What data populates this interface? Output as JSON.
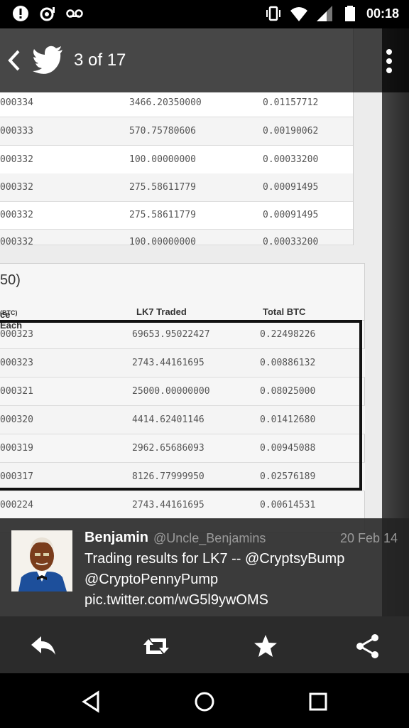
{
  "status_bar": {
    "time": "00:18",
    "left_icons": [
      "alert-icon",
      "sync-icon",
      "voicemail-icon"
    ],
    "right_icons": [
      "vibrate-icon",
      "wifi-icon",
      "cell-signal-icon",
      "battery-icon"
    ]
  },
  "appbar": {
    "title": "3 of 17"
  },
  "photo": {
    "top_table": {
      "rows": [
        [
          "000334",
          "3466.20350000",
          "0.01157712"
        ],
        [
          "000333",
          "570.75780606",
          "0.00190062"
        ],
        [
          "000332",
          "100.00000000",
          "0.00033200"
        ],
        [
          "000332",
          "275.58611779",
          "0.00091495"
        ],
        [
          "000332",
          "275.58611779",
          "0.00091495"
        ],
        [
          "000332",
          "100.00000000",
          "0.00033200"
        ]
      ]
    },
    "trades_panel": {
      "title": "50)",
      "headers": {
        "price": "ce Each",
        "price_unit": "(BTC)",
        "traded": "LK7 Traded",
        "total": "Total BTC"
      },
      "rows": [
        [
          "000323",
          "69653.95022427",
          "0.22498226"
        ],
        [
          "000323",
          "2743.44161695",
          "0.00886132"
        ],
        [
          "000321",
          "25000.00000000",
          "0.08025000"
        ],
        [
          "000320",
          "4414.62401146",
          "0.01412680"
        ],
        [
          "000319",
          "2962.65686093",
          "0.00945088"
        ],
        [
          "000317",
          "8126.77999950",
          "0.02576189"
        ],
        [
          "000224",
          "2743.44161695",
          "0.00614531"
        ]
      ]
    }
  },
  "tweet": {
    "name": "Benjamin",
    "handle": "@Uncle_Benjamins",
    "date": "20 Feb 14",
    "text": "Trading results for LK7 -- @CryptsyBump @CryptoPennyPump pic.twitter.com/wG5l9ywOMS"
  },
  "actions": [
    "reply-icon",
    "retweet-icon",
    "favorite-icon",
    "share-icon"
  ],
  "navbar": [
    "back-nav-icon",
    "home-nav-icon",
    "recents-nav-icon"
  ],
  "colors": {
    "bar": "#2b2b2b",
    "overlay": "#222222",
    "handle": "#9a9a9a"
  }
}
